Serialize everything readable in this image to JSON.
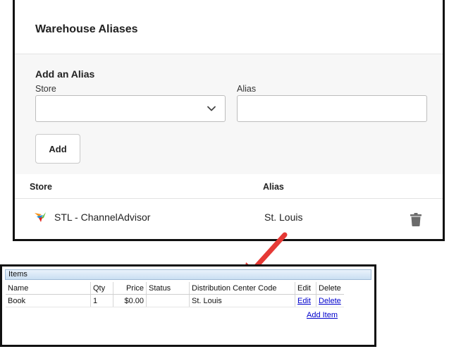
{
  "warehouse_aliases": {
    "title": "Warehouse Aliases",
    "form": {
      "title": "Add an Alias",
      "store_label": "Store",
      "store_selected": "",
      "alias_label": "Alias",
      "alias_value": "",
      "add_button": "Add"
    },
    "table": {
      "headers": {
        "store": "Store",
        "alias": "Alias"
      },
      "rows": [
        {
          "store": "STL - ChannelAdvisor",
          "alias": "St. Louis",
          "store_icon": "channeladvisor-logo-icon",
          "action_icon": "trash-icon"
        }
      ]
    }
  },
  "items_panel": {
    "title": "Items",
    "headers": [
      "Name",
      "Qty",
      "Price",
      "Status",
      "Distribution Center Code",
      "Edit",
      "Delete"
    ],
    "rows": [
      {
        "name": "Book",
        "qty": "1",
        "price": "$0.00",
        "status": "",
        "dc_code": "St. Louis",
        "edit": "Edit",
        "delete": "Delete"
      }
    ],
    "add_item": "Add Item"
  },
  "colors": {
    "arrow": "#e53935",
    "link": "#0000cc",
    "items_bar": "#cadff2",
    "form_background": "#f7f7f7",
    "border": "#111111"
  }
}
